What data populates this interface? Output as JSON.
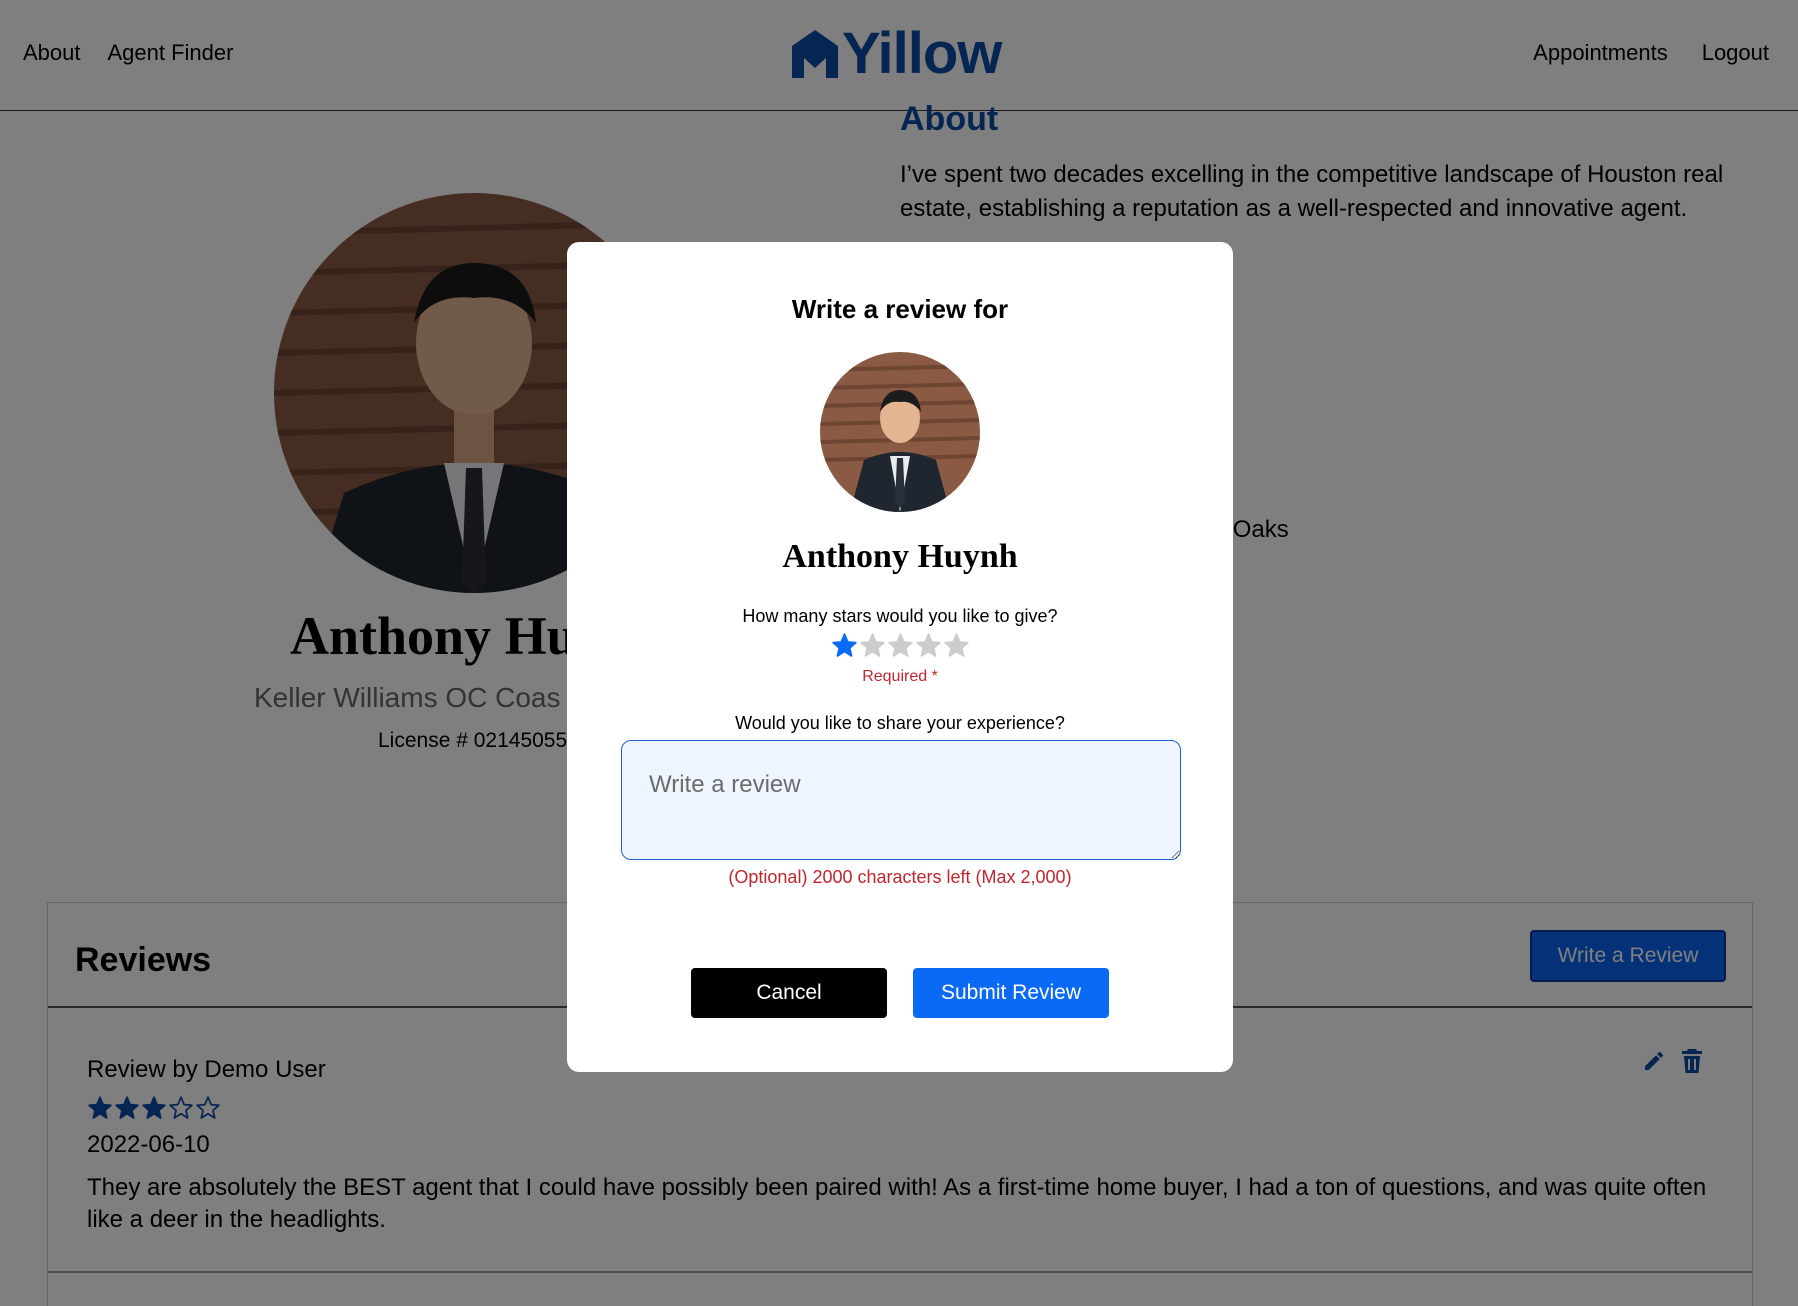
{
  "nav": {
    "left_links": [
      "About",
      "Agent Finder"
    ],
    "right_links": [
      "Appointments",
      "Logout"
    ],
    "logo_text": "Yillow"
  },
  "profile": {
    "about_title": "About",
    "about_text": "I’ve spent two decades excelling in the competitive landscape of Houston real estate, establishing a reputation as a well-respected and innovative agent.",
    "location_fragment": "sand Oaks",
    "name_visible": "Anthony Hu",
    "company_visible": "Keller Williams OC Coas",
    "license_visible": "License # 02145055"
  },
  "reviews": {
    "title": "Reviews",
    "write_button": "Write a Review",
    "items": [
      {
        "author": "Review by Demo User",
        "rating": 3,
        "max_rating": 5,
        "date": "2022-06-10",
        "body": "They are absolutely the BEST agent that I could have possibly been paired with! As a first-time home buyer, I had a ton of questions, and was quite often like a deer in the headlights."
      }
    ]
  },
  "modal": {
    "title": "Write a review for",
    "agent_name": "Anthony Huynh",
    "stars_question": "How many stars would you like to give?",
    "selected_stars": 1,
    "max_stars": 5,
    "required_note": "Required *",
    "share_question": "Would you like to share your experience?",
    "textarea_placeholder": "Write a review",
    "textarea_value": "",
    "char_count": "(Optional) 2000 characters left (Max 2,000)",
    "cancel_label": "Cancel",
    "submit_label": "Submit Review"
  },
  "colors": {
    "brand_blue": "#0a4aa6",
    "primary_button": "#0a6af5",
    "star_selected": "#0a6af5",
    "star_empty": "#cccccc",
    "error_red": "#c0262d",
    "overlay": "rgba(0,0,0,0.5)"
  },
  "icons": [
    "house-logo-icon",
    "star-icon",
    "edit-pencil-icon",
    "trash-icon"
  ]
}
